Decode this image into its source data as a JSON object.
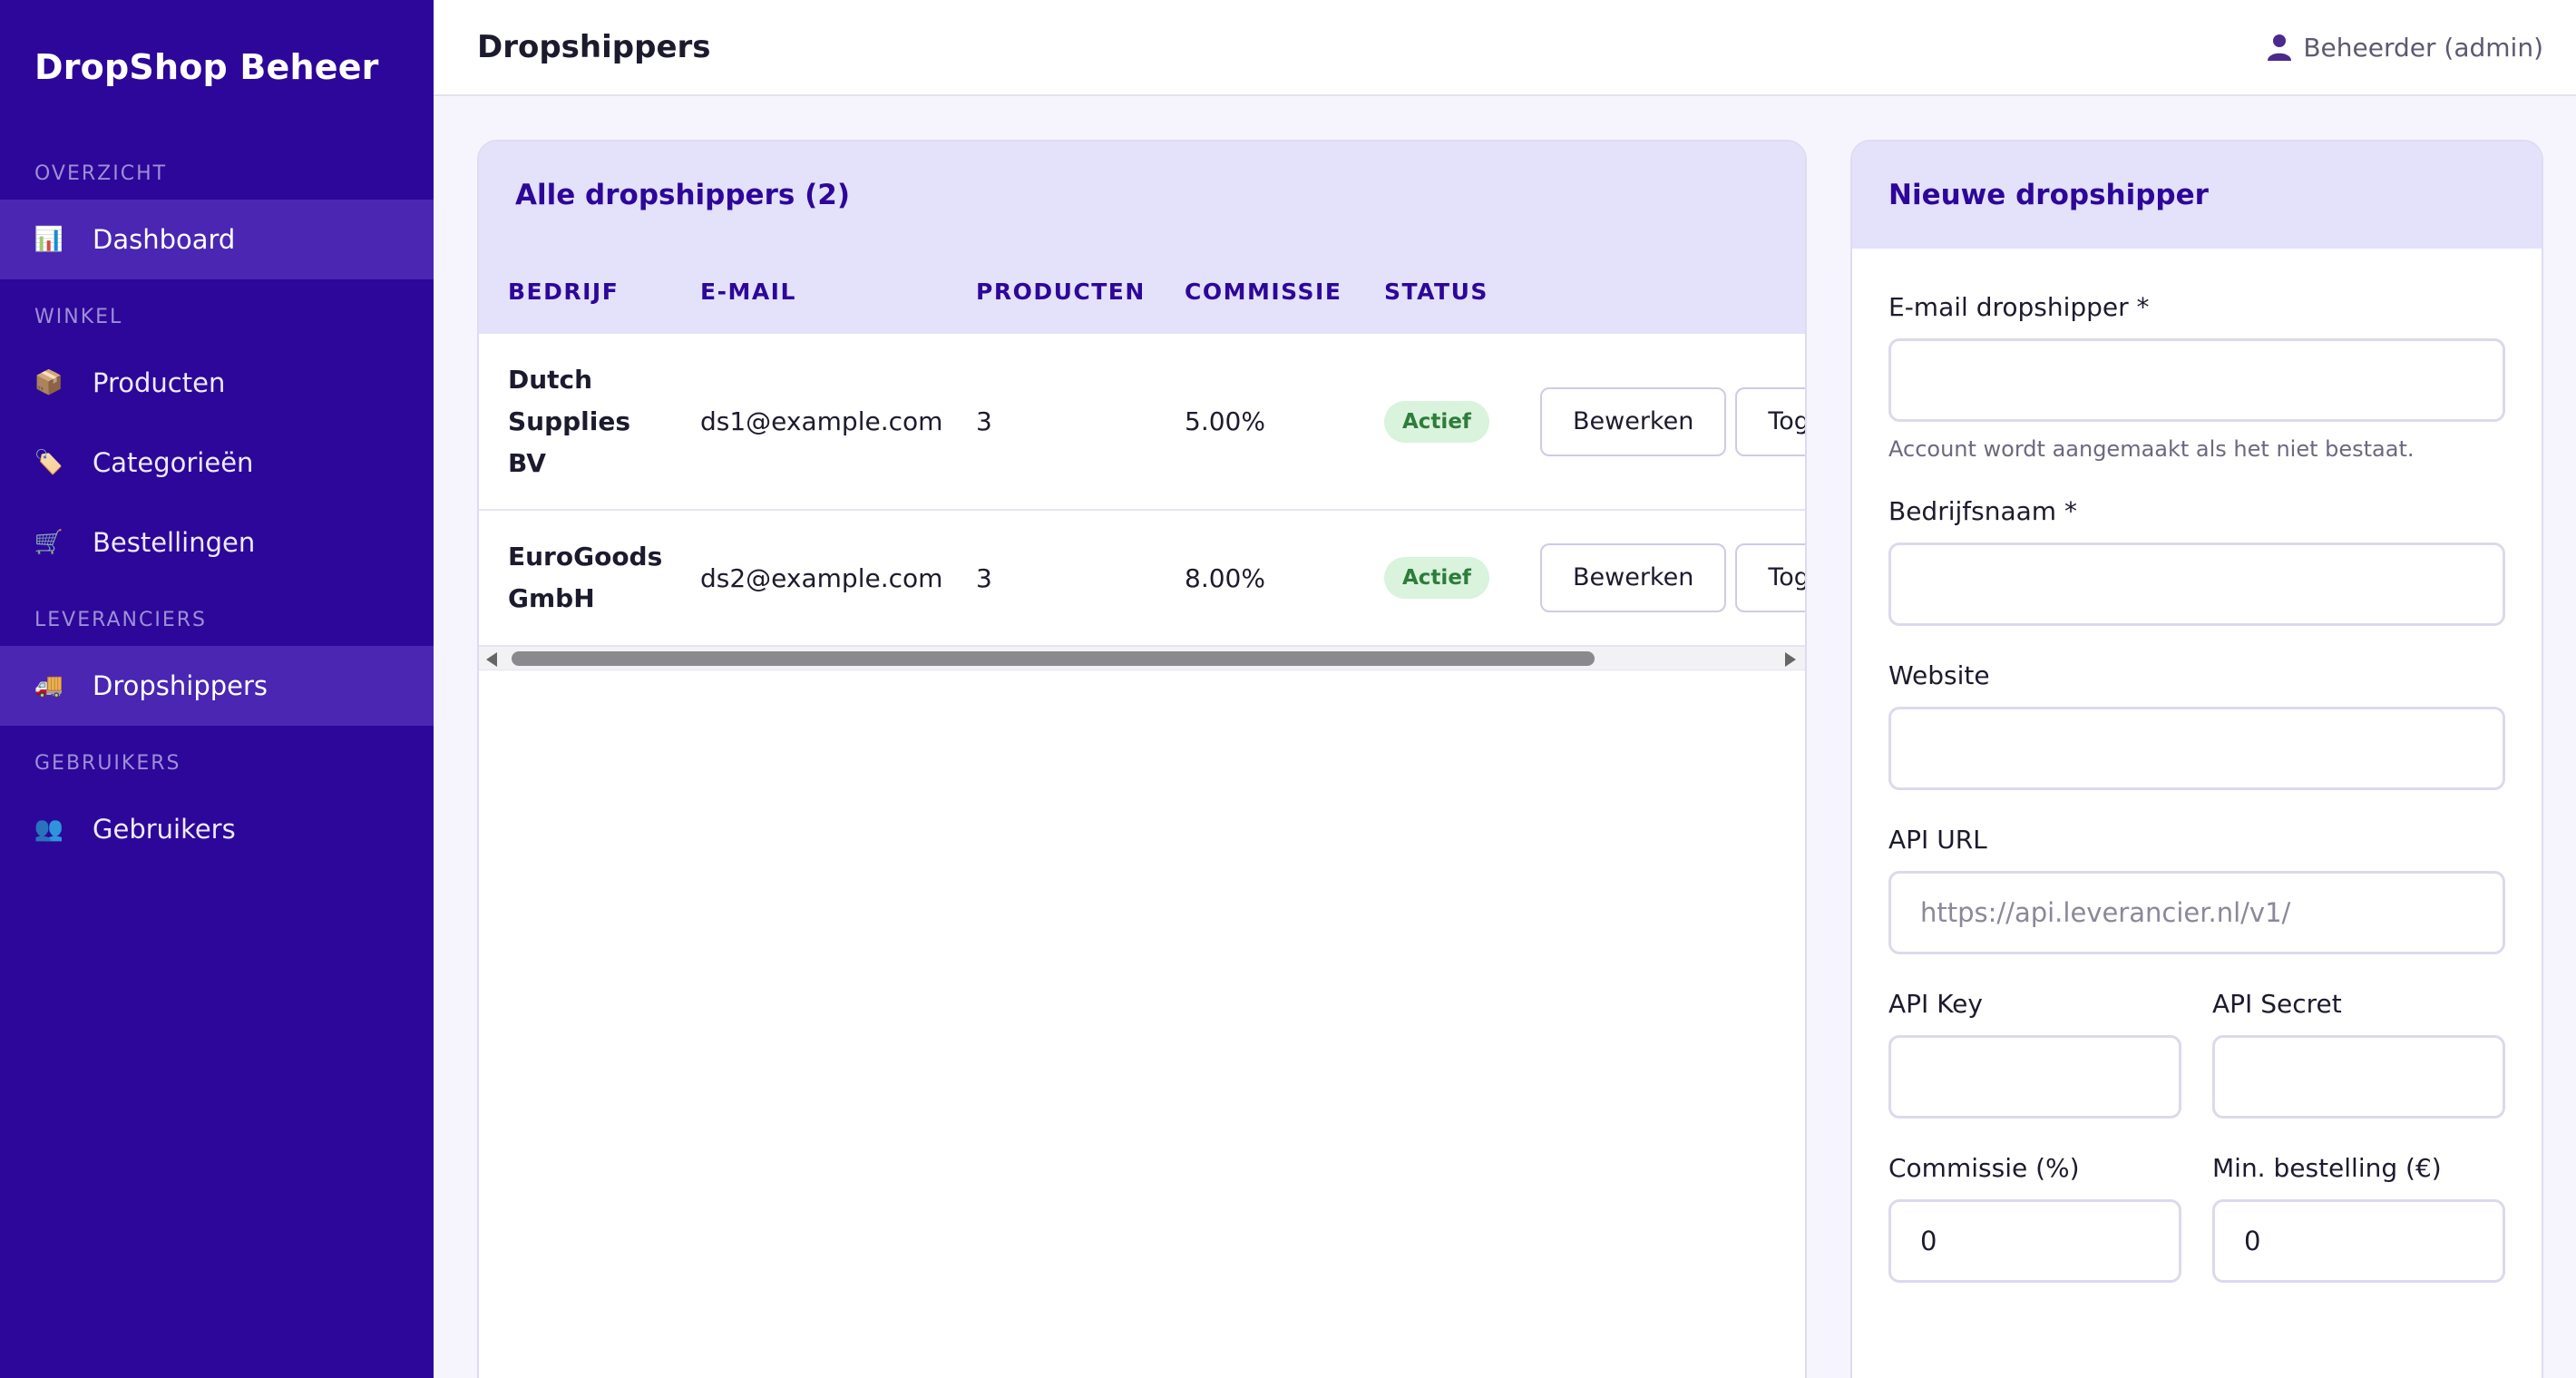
{
  "sidebar": {
    "brand": "DropShop Beheer",
    "sections": [
      {
        "title": "OVERZICHT",
        "items": [
          {
            "label": "Dashboard",
            "icon": "📊",
            "active": true
          }
        ]
      },
      {
        "title": "WINKEL",
        "items": [
          {
            "label": "Producten",
            "icon": "📦",
            "active": false
          },
          {
            "label": "Categorieën",
            "icon": "🏷️",
            "active": false
          },
          {
            "label": "Bestellingen",
            "icon": "🛒",
            "active": false
          }
        ]
      },
      {
        "title": "LEVERANCIERS",
        "items": [
          {
            "label": "Dropshippers",
            "icon": "🚚",
            "active": true
          }
        ]
      },
      {
        "title": "GEBRUIKERS",
        "items": [
          {
            "label": "Gebruikers",
            "icon": "👥",
            "active": false
          }
        ]
      }
    ]
  },
  "header": {
    "title": "Dropshippers",
    "user": "Beheerder (admin)"
  },
  "list": {
    "title": "Alle dropshippers (2)",
    "columns": [
      "BEDRIJF",
      "E-MAIL",
      "PRODUCTEN",
      "COMMISSIE",
      "STATUS",
      ""
    ],
    "rows": [
      {
        "company_lines": [
          "Dutch",
          "Supplies",
          "BV"
        ],
        "email": "ds1@example.com",
        "products": "3",
        "commission": "5.00%",
        "status": "Actief",
        "edit": "Bewerken",
        "toggle": "Toggle"
      },
      {
        "company_lines": [
          "EuroGoods",
          "GmbH"
        ],
        "email": "ds2@example.com",
        "products": "3",
        "commission": "8.00%",
        "status": "Actief",
        "edit": "Bewerken",
        "toggle": "Toggle"
      }
    ]
  },
  "form": {
    "title": "Nieuwe dropshipper",
    "email_label": "E-mail dropshipper *",
    "email_value": "",
    "email_hint": "Account wordt aangemaakt als het niet bestaat.",
    "company_label": "Bedrijfsnaam *",
    "company_value": "",
    "website_label": "Website",
    "website_value": "",
    "api_url_label": "API URL",
    "api_url_placeholder": "https://api.leverancier.nl/v1/",
    "api_key_label": "API Key",
    "api_secret_label": "API Secret",
    "commission_label": "Commissie (%)",
    "commission_value": "0",
    "min_order_label": "Min. bestelling (€)",
    "min_order_value": "0"
  },
  "colors": {
    "sidebar_bg": "#2d0799",
    "active_item": "#4a26b3",
    "accent": "#2d0799",
    "badge_bg": "#d9f3dd",
    "badge_text": "#2e7d3a"
  }
}
